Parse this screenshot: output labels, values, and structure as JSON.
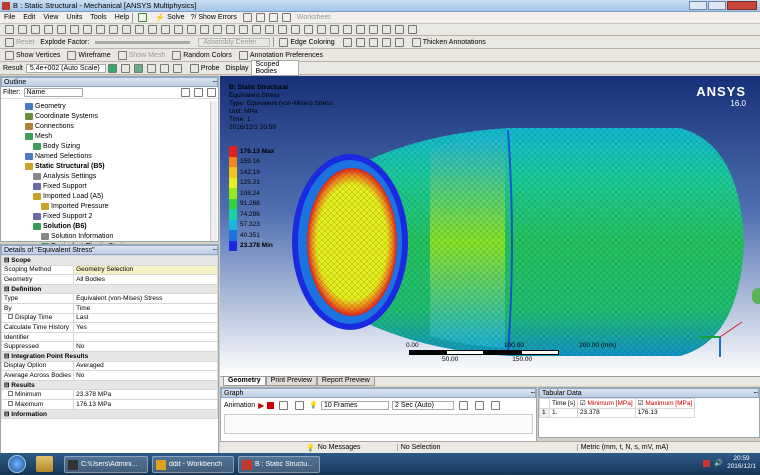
{
  "title_bar": {
    "title": "B : Static Structural - Mechanical [ANSYS Multiphysics]"
  },
  "menu": [
    "File",
    "Edit",
    "View",
    "Units",
    "Tools",
    "Help"
  ],
  "toolbar1": {
    "solve": "Solve",
    "show_errors": "?/ Show Errors",
    "worksheet": "Worksheet"
  },
  "toolbar3": {
    "show_vertices": "Show Vertices",
    "wireframe": "Wireframe",
    "show_mesh": "Show Mesh",
    "random_colors": "Random Colors",
    "annotation_prefs": "Annotation Preferences"
  },
  "toolbar2": {
    "reset": "Reset",
    "explode_factor": "Explode Factor:",
    "assembly_center": "Assembly Center",
    "edge_coloring": "Edge Coloring",
    "thicken": "Thicken Annotations"
  },
  "toolbar4": {
    "result_label": "Result",
    "result_value": "5.4e+002 (Auto Scale)",
    "probe": "Probe",
    "display_label": "Display",
    "display_value": "Scoped Bodies"
  },
  "outline": {
    "title": "Outline",
    "filter_label": "Filter:",
    "filter_value": "Name",
    "items": [
      {
        "label": "Geometry",
        "indent": 1,
        "bold": false,
        "color": "#4a7abf"
      },
      {
        "label": "Coordinate Systems",
        "indent": 1,
        "bold": false,
        "color": "#6a8f3a"
      },
      {
        "label": "Connections",
        "indent": 1,
        "bold": false,
        "color": "#b0803a"
      },
      {
        "label": "Mesh",
        "indent": 1,
        "bold": false,
        "color": "#3aa05a"
      },
      {
        "label": "Body Sizing",
        "indent": 2,
        "bold": false,
        "color": "#3aa05a"
      },
      {
        "label": "Named Selections",
        "indent": 1,
        "bold": false,
        "color": "#4a7abf"
      },
      {
        "label": "Static Structural (B5)",
        "indent": 1,
        "bold": true,
        "color": "#c9a227"
      },
      {
        "label": "Analysis Settings",
        "indent": 2,
        "bold": false,
        "color": "#888888"
      },
      {
        "label": "Fixed Support",
        "indent": 2,
        "bold": false,
        "color": "#6a6aa8"
      },
      {
        "label": "Imported Load (A5)",
        "indent": 2,
        "bold": false,
        "color": "#c9a227"
      },
      {
        "label": "Imported Pressure",
        "indent": 3,
        "bold": false,
        "color": "#c9a227"
      },
      {
        "label": "Fixed Support 2",
        "indent": 2,
        "bold": false,
        "color": "#6a6aa8"
      },
      {
        "label": "Solution (B6)",
        "indent": 2,
        "bold": true,
        "color": "#3a9a5a"
      },
      {
        "label": "Solution Information",
        "indent": 3,
        "bold": false,
        "color": "#888888"
      },
      {
        "label": "Equivalent Elastic Strain",
        "indent": 3,
        "bold": false,
        "color": "#3a9a5a"
      },
      {
        "label": "Equivalent Stress",
        "indent": 3,
        "bold": false,
        "color": "#3a9a5a",
        "selected": true
      }
    ]
  },
  "details": {
    "title": "Details of \"Equivalent Stress\"",
    "rows": [
      {
        "section": "Scope"
      },
      {
        "k": "Scoping Method",
        "v": "Geometry Selection",
        "hl": true
      },
      {
        "k": "Geometry",
        "v": "All Bodies"
      },
      {
        "section": "Definition"
      },
      {
        "k": "Type",
        "v": "Equivalent (von-Mises) Stress"
      },
      {
        "k": "By",
        "v": "Time"
      },
      {
        "k": "Display Time",
        "v": "Last",
        "cb": true
      },
      {
        "k": "Calculate Time History",
        "v": "Yes"
      },
      {
        "k": "Identifier",
        "v": ""
      },
      {
        "k": "Suppressed",
        "v": "No"
      },
      {
        "section": "Integration Point Results"
      },
      {
        "k": "Display Option",
        "v": "Averaged"
      },
      {
        "k": "Average Across Bodies",
        "v": "No"
      },
      {
        "section": "Results"
      },
      {
        "k": "Minimum",
        "v": "23.378 MPa",
        "cb": true
      },
      {
        "k": "Maximum",
        "v": "176.13 MPa",
        "cb": true
      },
      {
        "section": "Information"
      }
    ]
  },
  "viewport": {
    "header": [
      "B: Static Structural",
      "Equivalent Stress",
      "Type: Equivalent (von-Mises) Stress",
      "Unit: MPa",
      "Time: 1",
      "2016/12/1 20:59"
    ],
    "brand": "ANSYS",
    "version": "16.0",
    "legend": [
      {
        "label": "176.13 Max",
        "color": "#e0201b"
      },
      {
        "label": "159.16",
        "color": "#f2871b"
      },
      {
        "label": "142.19",
        "color": "#f5c21b"
      },
      {
        "label": "125.21",
        "color": "#e6ee1b"
      },
      {
        "label": "108.24",
        "color": "#9be81b"
      },
      {
        "label": "91.268",
        "color": "#2fd33c"
      },
      {
        "label": "74.296",
        "color": "#19d3a5"
      },
      {
        "label": "57.323",
        "color": "#1bb7e0"
      },
      {
        "label": "40.351",
        "color": "#1b72e0"
      },
      {
        "label": "23.378 Min",
        "color": "#1b2ae0"
      }
    ],
    "scale": {
      "t0": "0.00",
      "t1": "100.00",
      "t2": "200.00 (mm)",
      "b1": "50.00",
      "b2": "150.00"
    }
  },
  "view_tabs": [
    "Geometry",
    "Print Preview",
    "Report Preview"
  ],
  "graph": {
    "title": "Graph",
    "animation": "Animation",
    "frames": "10 Frames",
    "duration": "2 Sec (Auto)",
    "tabs": [
      "Messages",
      "Graph"
    ]
  },
  "tabular": {
    "title": "Tabular Data",
    "columns": [
      "Time [s]",
      "Minimum [MPa]",
      "Maximum [MPa]"
    ],
    "row": [
      "1",
      "1.",
      "23.378",
      "176.13"
    ]
  },
  "status": {
    "messages": "No Messages",
    "selection": "No Selection",
    "units": "Metric (mm, t, N, s, mV, mA)"
  },
  "taskbar": {
    "items": [
      "C:\\Users\\Admini...",
      "ddd - Workbench",
      "B : Static Structu..."
    ],
    "time": "20:59",
    "date": "2016/12/1"
  },
  "colors": {
    "accent": "#1f66c4",
    "bg_top": "#17307a",
    "bg_bottom": "#ffffff"
  }
}
